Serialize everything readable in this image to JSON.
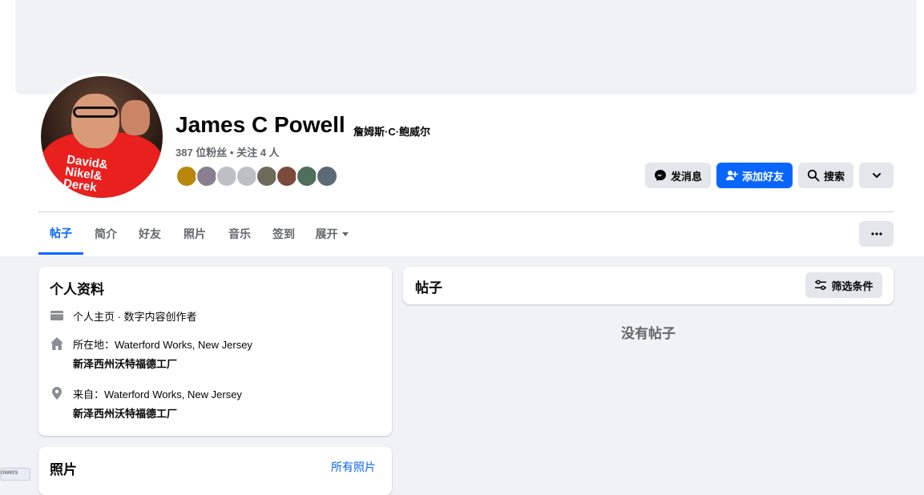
{
  "profile": {
    "name": "James C Powell",
    "alt_name": "詹姆斯·C·鲍威尔",
    "stats": "387 位粉丝 • 关注 4 人",
    "avatar_text_1": "David&",
    "avatar_text_2": "Nikel&",
    "avatar_text_3": "Derek"
  },
  "actions": {
    "message": "发消息",
    "add_friend": "添加好友",
    "search": "搜索"
  },
  "friend_avatars": [
    {
      "color": "#b8860b"
    },
    {
      "color": "#8a7f8e"
    },
    {
      "color": "#bcc0c4"
    },
    {
      "color": "#bcc0c4"
    },
    {
      "color": "#6d6a5a"
    },
    {
      "color": "#7a4b3a"
    },
    {
      "color": "#4f6e5c"
    },
    {
      "color": "#5b6a74"
    }
  ],
  "tabs": [
    "帖子",
    "简介",
    "好友",
    "照片",
    "音乐",
    "签到",
    "展开"
  ],
  "intro": {
    "title": "个人资料",
    "page_line": "个人主页 · 数字内容创作者",
    "lives_line": "所在地：Waterford Works, New Jersey",
    "lives_sub": "新泽西州沃特福德工厂",
    "from_line": "来自：Waterford Works, New Jersey",
    "from_sub": "新泽西州沃特福德工厂"
  },
  "posts": {
    "title": "帖子",
    "filter": "筛选条件",
    "empty": "没有帖子"
  },
  "photos": {
    "title": "照片",
    "all_link": "所有照片"
  },
  "side_tab": "owers",
  "colors": {
    "accent": "#0866ff",
    "secondary_text": "#65676b",
    "background": "#f0f2f5"
  }
}
